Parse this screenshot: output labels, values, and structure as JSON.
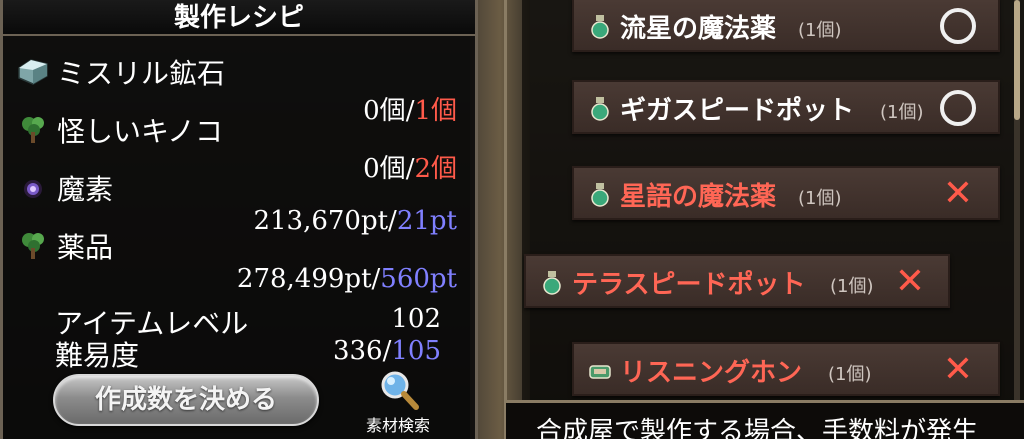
{
  "recipe": {
    "title": "製作レシピ",
    "materials": [
      {
        "name": "ミスリル鉱石",
        "icon": "ore-icon",
        "have": "0個",
        "sep": "/",
        "need": "1個"
      },
      {
        "name": "怪しいキノコ",
        "icon": "herb-icon",
        "have": "0個",
        "sep": "/",
        "need": "2個"
      },
      {
        "name": "魔素",
        "icon": "magic-orb-icon",
        "have": "213,670pt",
        "sep": "/",
        "need": "21pt"
      },
      {
        "name": "薬品",
        "icon": "herb-icon",
        "have": "278,499pt",
        "sep": "/",
        "need": "560pt"
      }
    ],
    "item_level_label": "アイテムレベル",
    "item_level_value": "102",
    "difficulty_label": "難易度",
    "difficulty_have": "336",
    "difficulty_sep": "/",
    "difficulty_need": "105",
    "make_button": "作成数を決める",
    "search_button": "素材検索"
  },
  "list": {
    "items": [
      {
        "name": "流星の魔法薬",
        "qty": "(1個)",
        "mark": "○",
        "available": true
      },
      {
        "name": "ギガスピードポット",
        "qty": "(1個)",
        "mark": "○",
        "available": true
      },
      {
        "name": "星語の魔法薬",
        "qty": "(1個)",
        "mark": "✕",
        "available": false
      },
      {
        "name": "テラスピードポット",
        "qty": "(1個)",
        "mark": "✕",
        "available": false
      },
      {
        "name": "リスニングホン",
        "qty": "(1個)",
        "mark": "✕",
        "available": false
      }
    ]
  },
  "footer": {
    "message": "合成屋で製作する場合、手数料が発生"
  },
  "colors": {
    "need_red": "#ff5a4a",
    "need_blue": "#8080ff",
    "unavailable_red": "#ff6655"
  }
}
